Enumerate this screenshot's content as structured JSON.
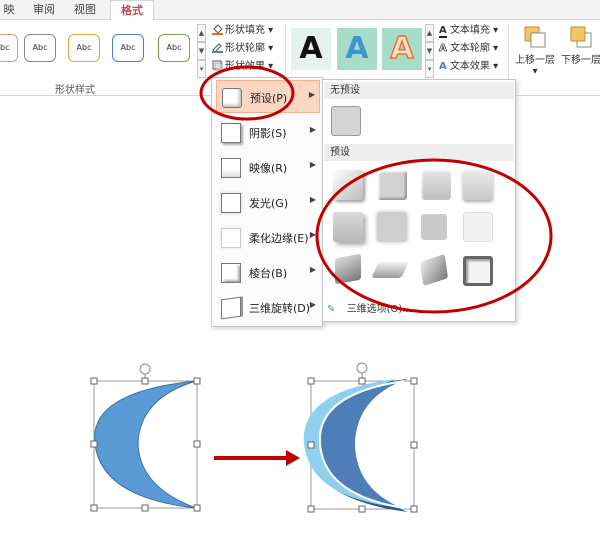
{
  "ribbon": {
    "tabs": [
      "映",
      "审阅",
      "视图",
      "格式"
    ],
    "active_tab": "格式",
    "style_thumbs": [
      "Abc",
      "Abc",
      "Abc",
      "Abc",
      "Abc"
    ],
    "group_label": "形状样式",
    "commands": {
      "fill": "形状填充",
      "outline": "形状轮廓",
      "effects": "形状效果"
    },
    "wordart_glyph": "A",
    "text_commands": {
      "fill": "文本填充",
      "outline": "文本轮廓",
      "effects": "文本效果"
    },
    "arrange": {
      "bring_forward": "上移一层",
      "send_backward": "下移一层"
    }
  },
  "menu": {
    "items": [
      {
        "label": "预设(P)",
        "highlighted": true
      },
      {
        "label": "阴影(S)"
      },
      {
        "label": "映像(R)"
      },
      {
        "label": "发光(G)"
      },
      {
        "label": "柔化边缘(E)"
      },
      {
        "label": "棱台(B)"
      },
      {
        "label": "三维旋转(D)"
      }
    ]
  },
  "submenu": {
    "no_preset_header": "无预设",
    "preset_header": "预设",
    "footer": "三维选项(O)..."
  },
  "colors": {
    "accent": "#c0504d",
    "annotation": "#c00000",
    "shape_fill": "#5b9bd5"
  }
}
